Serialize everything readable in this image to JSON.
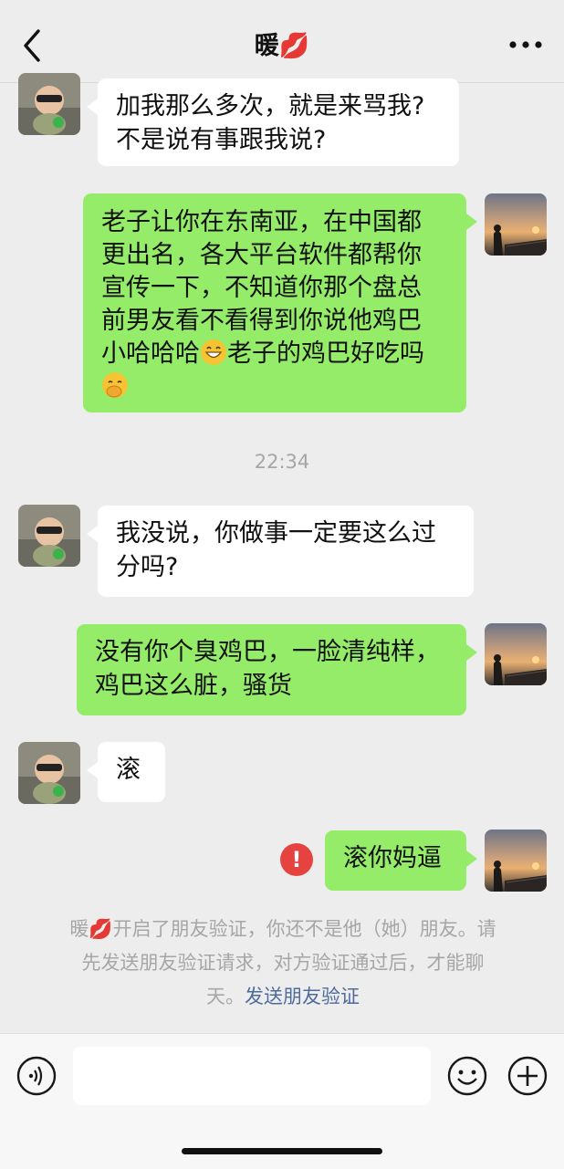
{
  "header": {
    "title": "暖💋",
    "back_icon": "chevron-left-icon",
    "more_icon": "ellipsis-icon"
  },
  "messages": [
    {
      "side": "in",
      "text_lines": [
        "加我那么多次，就是来骂我?",
        "不是说有事跟我说?"
      ]
    },
    {
      "side": "out",
      "text_lines": [
        "老子让你在东南亚，在中国都",
        "更出名，各大平台软件都帮你",
        "宣传一下，不知道你那个盘总",
        "前男友看不看得到你说他鸡巴",
        "小哈哈哈",
        "老子的鸡巴好吃吗"
      ],
      "emojis": [
        "grinning-face",
        "face-with-hand-over-mouth"
      ]
    },
    {
      "side": "in",
      "text_lines": [
        "我没说，你做事一定要这么过",
        "分吗?"
      ]
    },
    {
      "side": "out",
      "text_lines": [
        "没有你个臭鸡巴，一脸清纯样，",
        "鸡巴这么脏，骚货"
      ]
    },
    {
      "side": "in",
      "text_lines": [
        "滚"
      ]
    },
    {
      "side": "out",
      "text_lines": [
        "滚你妈逼"
      ],
      "failed": true
    }
  ],
  "timestamp": "22:34",
  "system_notice": {
    "lines": [
      "暖💋开启了朋友验证，你还不是他（她）朋友。请",
      "先发送朋友验证请求，对方验证通过后，才能聊",
      "天。"
    ],
    "link_text": "发送朋友验证"
  },
  "error_mark": "!",
  "input_bar": {
    "voice_icon": "voice-icon",
    "emoji_icon": "emoji-face-icon",
    "plus_icon": "plus-icon"
  },
  "colors": {
    "background": "#ededed",
    "outgoing_bubble": "#95ec69",
    "incoming_bubble": "#ffffff",
    "error": "#e64340",
    "link": "#4f6b9c"
  }
}
